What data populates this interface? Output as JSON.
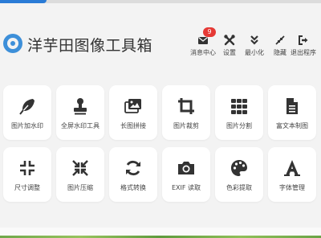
{
  "app": {
    "title": "洋芋田图像工具箱"
  },
  "toolbar": {
    "messages": {
      "label": "消息中心",
      "badge": "9",
      "icon": "envelope-icon"
    },
    "settings": {
      "label": "设置",
      "icon": "tools-icon"
    },
    "minimize": {
      "label": "最小化",
      "icon": "double-chevron-down-icon"
    },
    "hide": {
      "label": "隐藏",
      "icon": "compress-arrows-icon"
    },
    "exit": {
      "label": "退出程序",
      "icon": "sign-out-icon"
    }
  },
  "tools": [
    {
      "label": "图片加水印",
      "icon": "feather-icon"
    },
    {
      "label": "全屏水印工具",
      "icon": "stamp-icon"
    },
    {
      "label": "长图拼接",
      "icon": "images-icon"
    },
    {
      "label": "图片裁剪",
      "icon": "crop-icon"
    },
    {
      "label": "图片分割",
      "icon": "grid-icon"
    },
    {
      "label": "富文本制图",
      "icon": "document-icon"
    },
    {
      "label": "尺寸调整",
      "icon": "compress-icon"
    },
    {
      "label": "图片压缩",
      "icon": "compress-arrows-icon"
    },
    {
      "label": "格式转换",
      "icon": "sync-icon"
    },
    {
      "label": "EXIF 读取",
      "icon": "camera-icon"
    },
    {
      "label": "色彩提取",
      "icon": "palette-icon"
    },
    {
      "label": "字体管理",
      "icon": "font-icon"
    }
  ],
  "colors": {
    "accent": "#2a7bd6",
    "badge": "#e53935",
    "icon": "#333333",
    "background": "#f3f3f3"
  }
}
